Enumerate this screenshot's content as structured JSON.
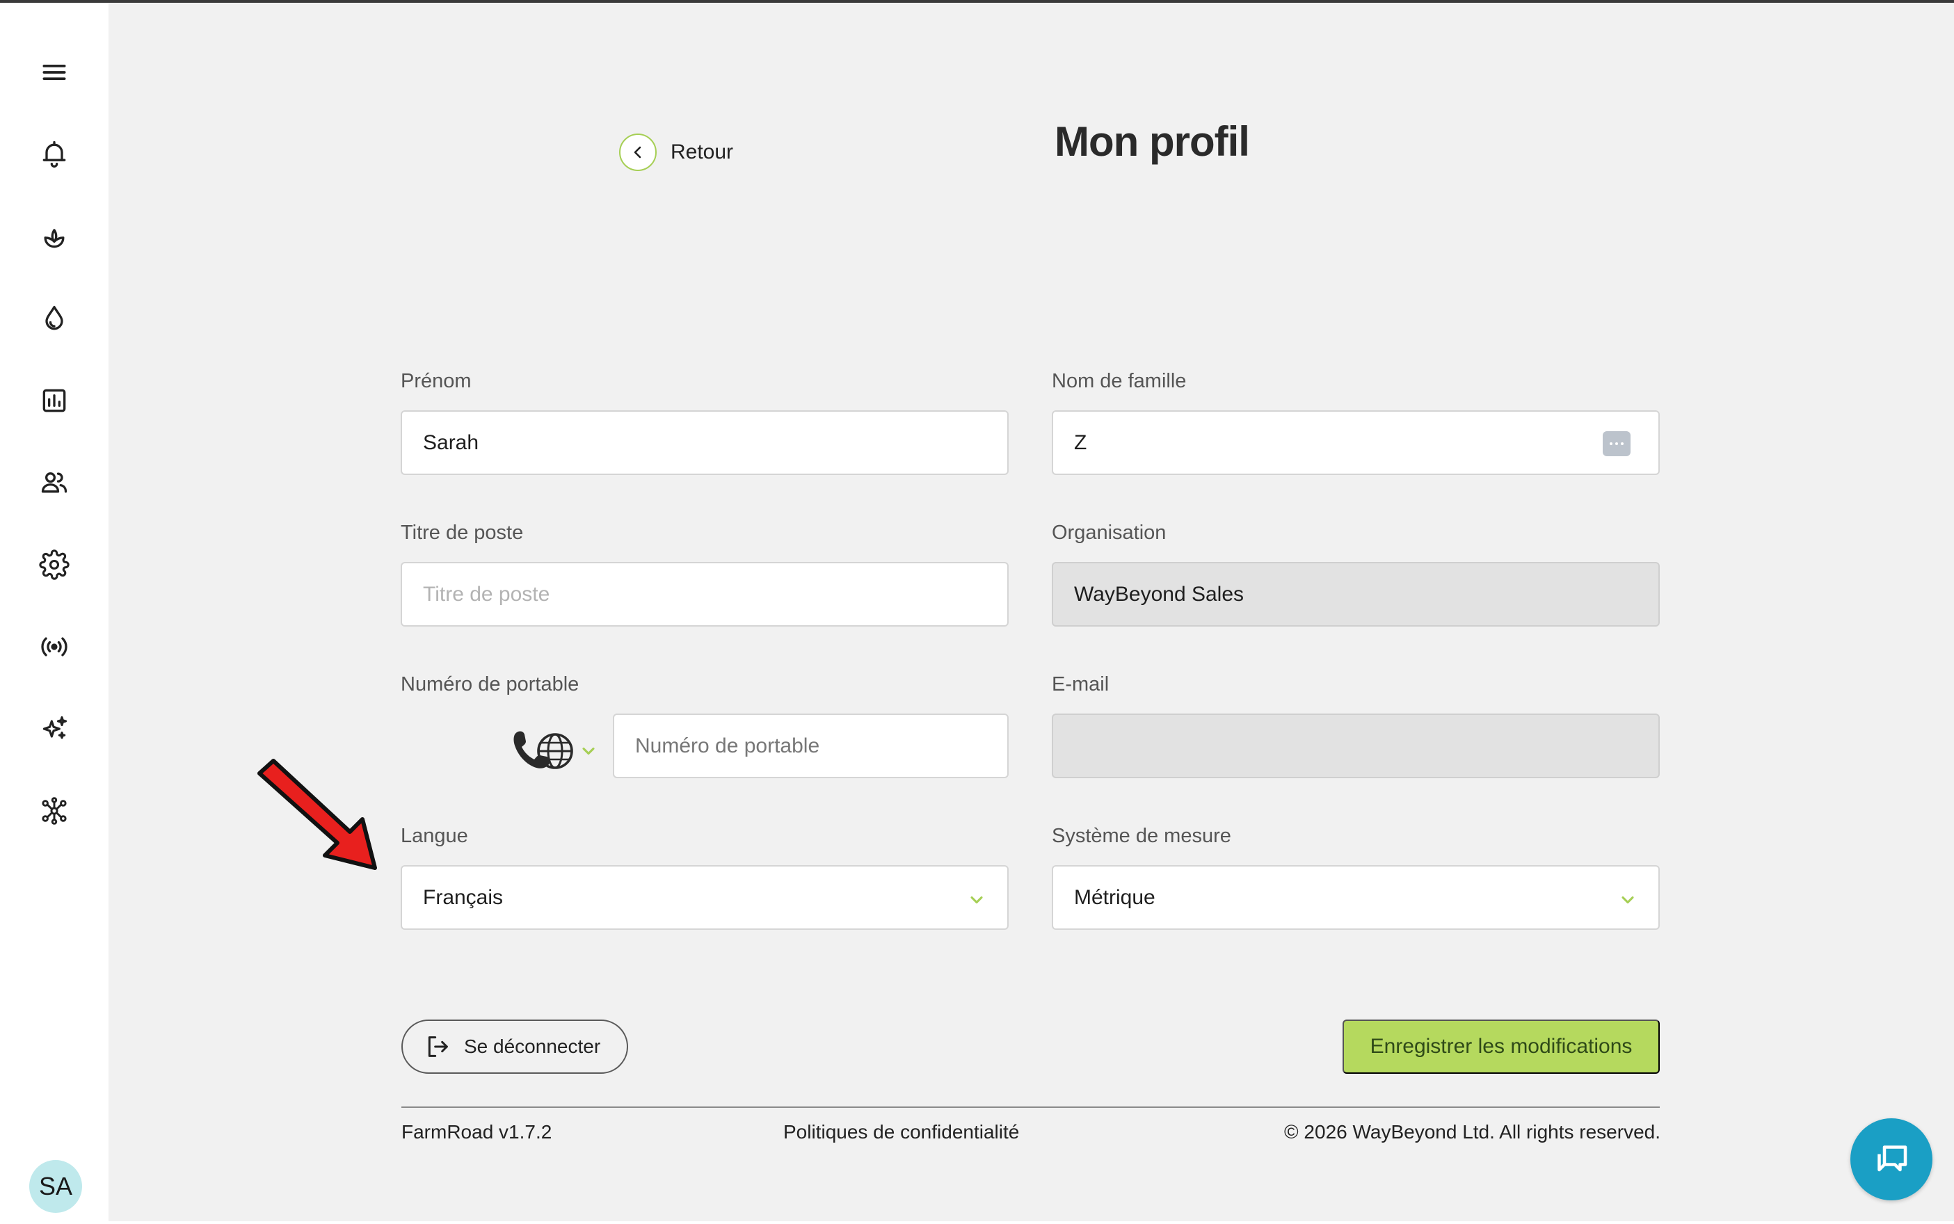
{
  "header": {
    "back_label": "Retour",
    "title": "Mon profil"
  },
  "form": {
    "first_name": {
      "label": "Prénom",
      "value": "Sarah"
    },
    "last_name": {
      "label": "Nom de famille",
      "value": "Z"
    },
    "job_title": {
      "label": "Titre de poste",
      "value": "",
      "placeholder": "Titre de poste"
    },
    "organisation": {
      "label": "Organisation",
      "value": "WayBeyond Sales"
    },
    "mobile": {
      "label": "Numéro de portable",
      "value": "",
      "placeholder": "Numéro de portable"
    },
    "email": {
      "label": "E-mail",
      "value": ""
    },
    "language": {
      "label": "Langue",
      "value": "Français"
    },
    "measurement": {
      "label": "Système de mesure",
      "value": "Métrique"
    }
  },
  "actions": {
    "logout_label": "Se déconnecter",
    "save_label": "Enregistrer les modifications"
  },
  "footer": {
    "version": "FarmRoad v1.7.2",
    "privacy": "Politiques de confidentialité",
    "copyright": "© 2026 WayBeyond Ltd. All rights reserved."
  },
  "sidebar": {
    "icons": [
      "menu-icon",
      "bell-icon",
      "plant-icon",
      "water-drop-icon",
      "report-icon",
      "users-icon",
      "gear-icon",
      "broadcast-icon",
      "sparkle-icon",
      "network-icon"
    ],
    "avatar_initials": "SA"
  },
  "colors": {
    "accent_green": "#b5d95e",
    "chat_blue": "#1a9fc5",
    "avatar_bg": "#bfe9ec",
    "annotation_red": "#e8201e"
  }
}
